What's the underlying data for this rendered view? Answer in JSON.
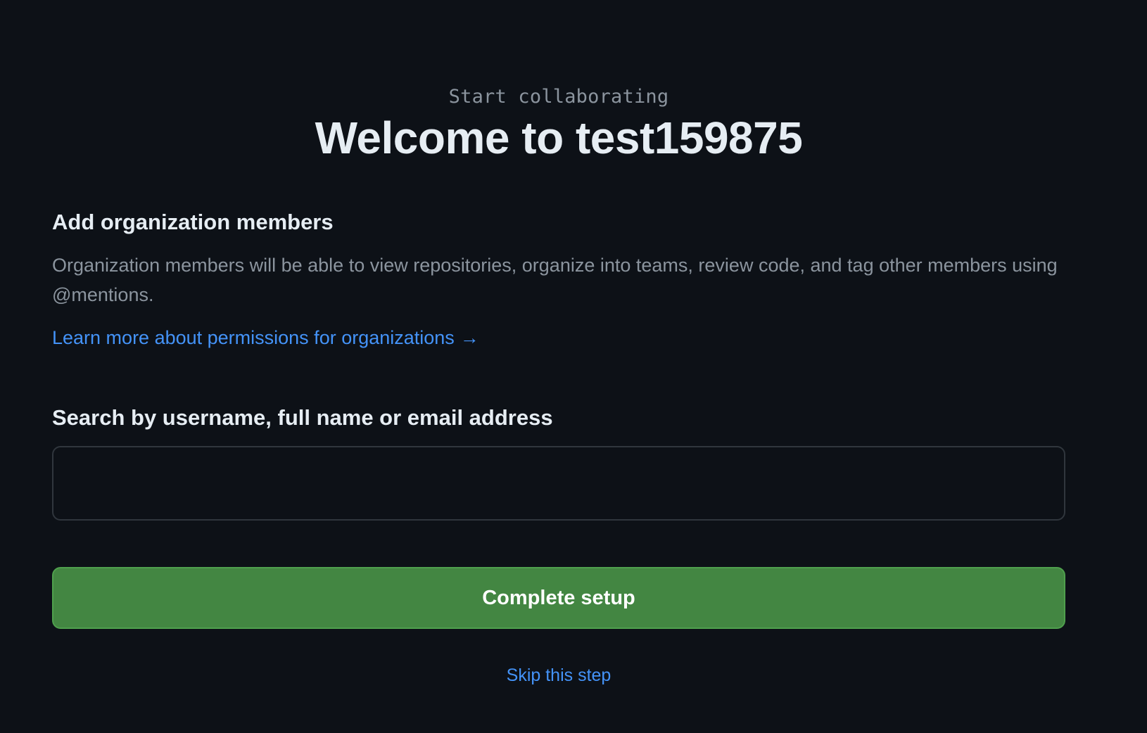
{
  "header": {
    "eyebrow": "Start collaborating",
    "title": "Welcome to test159875"
  },
  "members_section": {
    "heading": "Add organization members",
    "description": "Organization members will be able to view repositories, organize into teams, review code, and tag other members using @mentions.",
    "learn_more_link": "Learn more about permissions for organizations",
    "learn_more_arrow": "→"
  },
  "search": {
    "label": "Search by username, full name or email address",
    "value": "",
    "placeholder": ""
  },
  "actions": {
    "complete_label": "Complete setup",
    "skip_label": "Skip this step"
  },
  "colors": {
    "background": "#0d1117",
    "text_primary": "#e6edf3",
    "text_muted": "#8b949e",
    "link": "#4493f8",
    "button_green": "#438642",
    "input_border": "#30363d"
  },
  "icons": {
    "learn_more": "arrow-right-icon"
  }
}
